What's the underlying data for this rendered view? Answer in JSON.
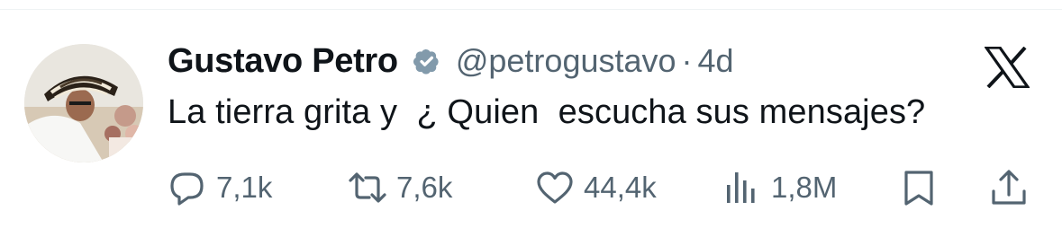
{
  "author": {
    "display_name": "Gustavo Petro",
    "handle": "@petrogustavo",
    "separator": "·",
    "timestamp": "4d",
    "verified": true
  },
  "tweet": {
    "text": "La tierra grita y  ¿ Quien  escucha sus mensajes?"
  },
  "actions": {
    "replies": "7,1k",
    "reposts": "7,6k",
    "likes": "44,4k",
    "views": "1,8M"
  },
  "icons": {
    "reply": "speech-bubble-icon",
    "repost": "repost-arrows-icon",
    "like": "heart-icon",
    "views": "bar-chart-icon",
    "bookmark": "bookmark-icon",
    "share": "share-upload-icon",
    "brand": "x-logo-icon",
    "verified": "verified-badge-icon"
  },
  "colors": {
    "text_primary": "#0f1419",
    "text_secondary": "#536471",
    "verified_badge": "#829aab"
  }
}
